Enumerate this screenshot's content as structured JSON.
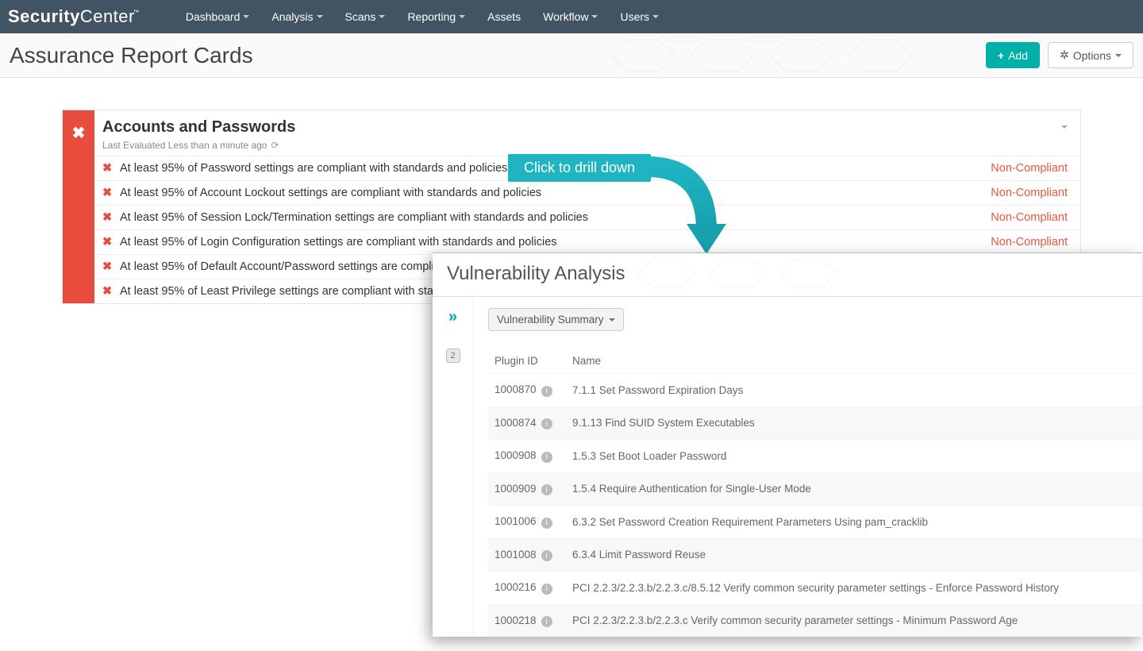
{
  "brand": {
    "left": "Security",
    "right": "Center"
  },
  "nav": [
    "Dashboard",
    "Analysis",
    "Scans",
    "Reporting",
    "Assets",
    "Workflow",
    "Users"
  ],
  "nav_has_caret": [
    true,
    true,
    true,
    true,
    false,
    true,
    true
  ],
  "page_title": "Assurance Report Cards",
  "add_label": "Add",
  "options_label": "Options",
  "card": {
    "title": "Accounts and Passwords",
    "subtitle": "Last Evaluated Less than a minute ago",
    "rows": [
      {
        "text": "At least 95% of Password settings are compliant with standards and policies",
        "status": "Non-Compliant"
      },
      {
        "text": "At least 95% of Account Lockout settings are compliant with standards and policies",
        "status": "Non-Compliant"
      },
      {
        "text": "At least 95% of Session Lock/Termination settings are compliant with standards and policies",
        "status": "Non-Compliant"
      },
      {
        "text": "At least 95% of Login Configuration settings are compliant with standards and policies",
        "status": "Non-Compliant"
      },
      {
        "text": "At least 95% of Default Account/Password settings are compliant with standards and policies",
        "status": ""
      },
      {
        "text": "At least 95% of Least Privilege settings are compliant with standards and policies",
        "status": ""
      }
    ]
  },
  "callout": "Click to drill down",
  "panel": {
    "title": "Vulnerability Analysis",
    "dropdown": "Vulnerability Summary",
    "badge": "2",
    "headers": {
      "id": "Plugin ID",
      "name": "Name"
    },
    "rows": [
      {
        "id": "1000870",
        "name": "7.1.1 Set Password Expiration Days"
      },
      {
        "id": "1000874",
        "name": "9.1.13 Find SUID System Executables"
      },
      {
        "id": "1000908",
        "name": "1.5.3 Set Boot Loader Password"
      },
      {
        "id": "1000909",
        "name": "1.5.4 Require Authentication for Single-User Mode"
      },
      {
        "id": "1001006",
        "name": "6.3.2 Set Password Creation Requirement Parameters Using pam_cracklib"
      },
      {
        "id": "1001008",
        "name": "6.3.4 Limit Password Reuse"
      },
      {
        "id": "1000216",
        "name": "PCI 2.2.3/2.2.3.b/2.2.3.c/8.5.12 Verify common security parameter settings - Enforce Password History"
      },
      {
        "id": "1000218",
        "name": "PCI 2.2.3/2.2.3.b/2.2.3.c Verify common security parameter settings - Minimum Password Age"
      }
    ]
  }
}
